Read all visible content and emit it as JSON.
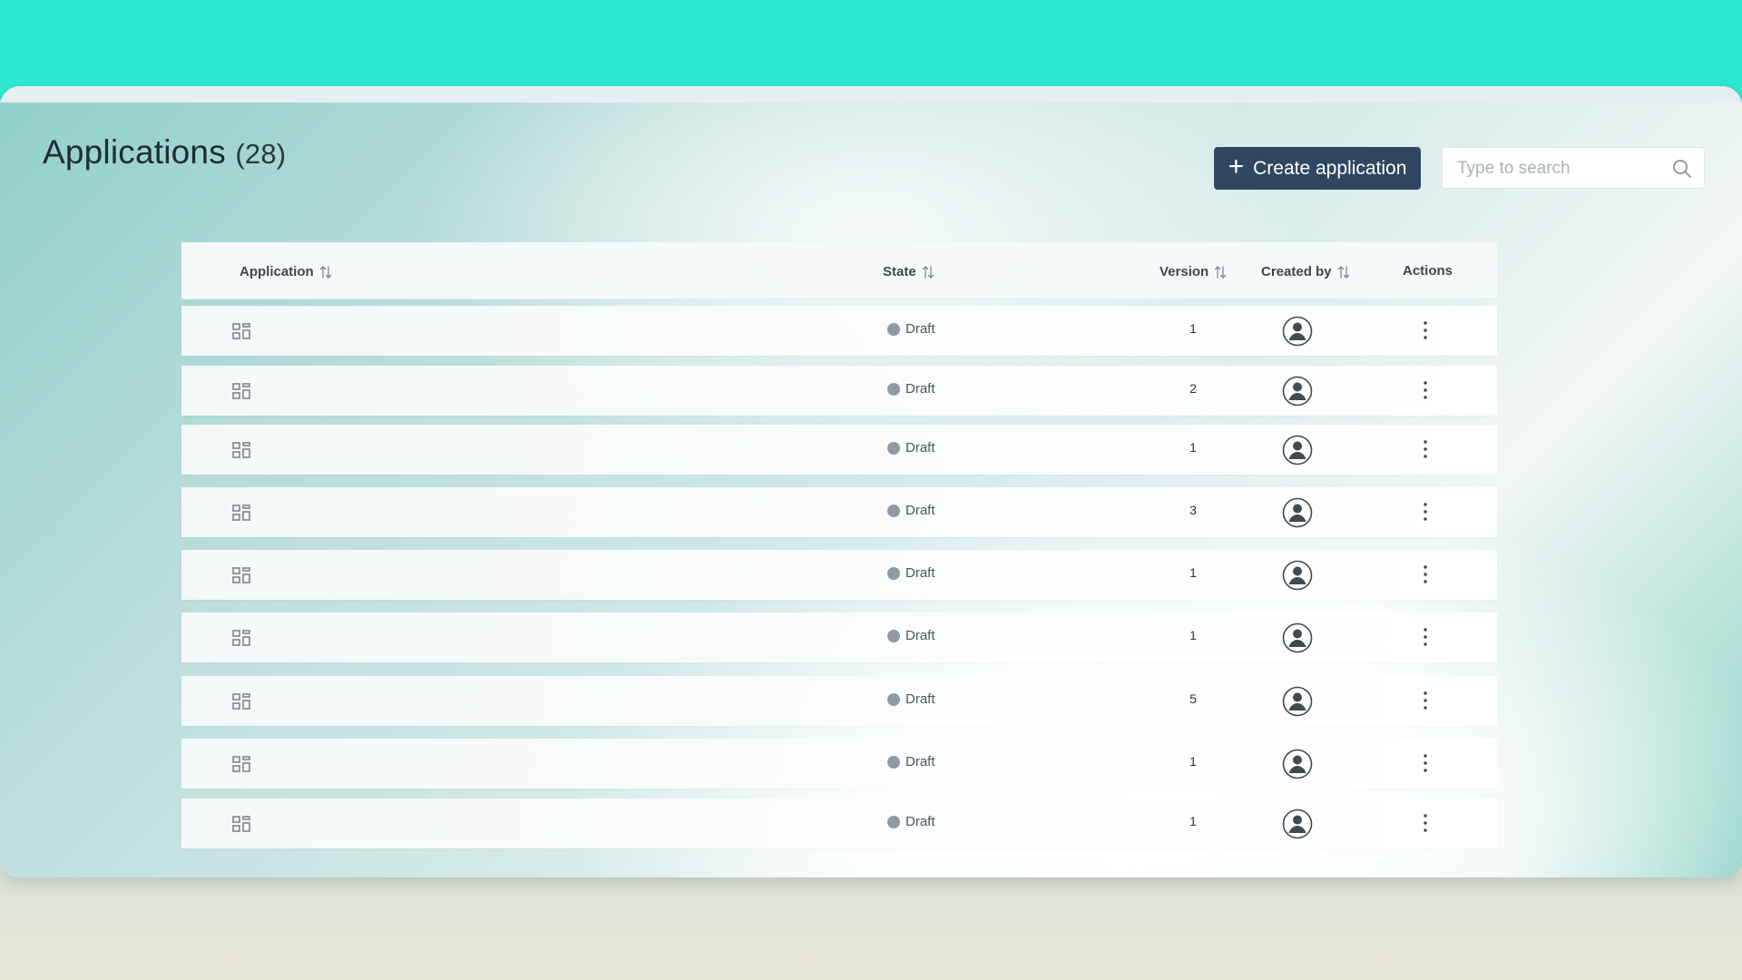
{
  "header": {
    "title": "Applications",
    "count": "(28)",
    "create_label": "Create application",
    "search_placeholder": "Type to search"
  },
  "table": {
    "columns": {
      "application": "Application",
      "state": "State",
      "version": "Version",
      "created_by": "Created by",
      "actions": "Actions"
    },
    "rows": [
      {
        "state": "Draft",
        "version": "1"
      },
      {
        "state": "Draft",
        "version": "2"
      },
      {
        "state": "Draft",
        "version": "1"
      },
      {
        "state": "Draft",
        "version": "3"
      },
      {
        "state": "Draft",
        "version": "1"
      },
      {
        "state": "Draft",
        "version": "1"
      },
      {
        "state": "Draft",
        "version": "5"
      },
      {
        "state": "Draft",
        "version": "1"
      },
      {
        "state": "Draft",
        "version": "1"
      }
    ]
  },
  "colors": {
    "accent": "#2f4761",
    "teal": "#2ee9d2",
    "draft_dot": "#8e9aa6"
  },
  "icons": [
    "plus-icon",
    "search-icon",
    "sort-icon",
    "application-grid-icon",
    "user-avatar-icon",
    "more-vertical-icon"
  ]
}
